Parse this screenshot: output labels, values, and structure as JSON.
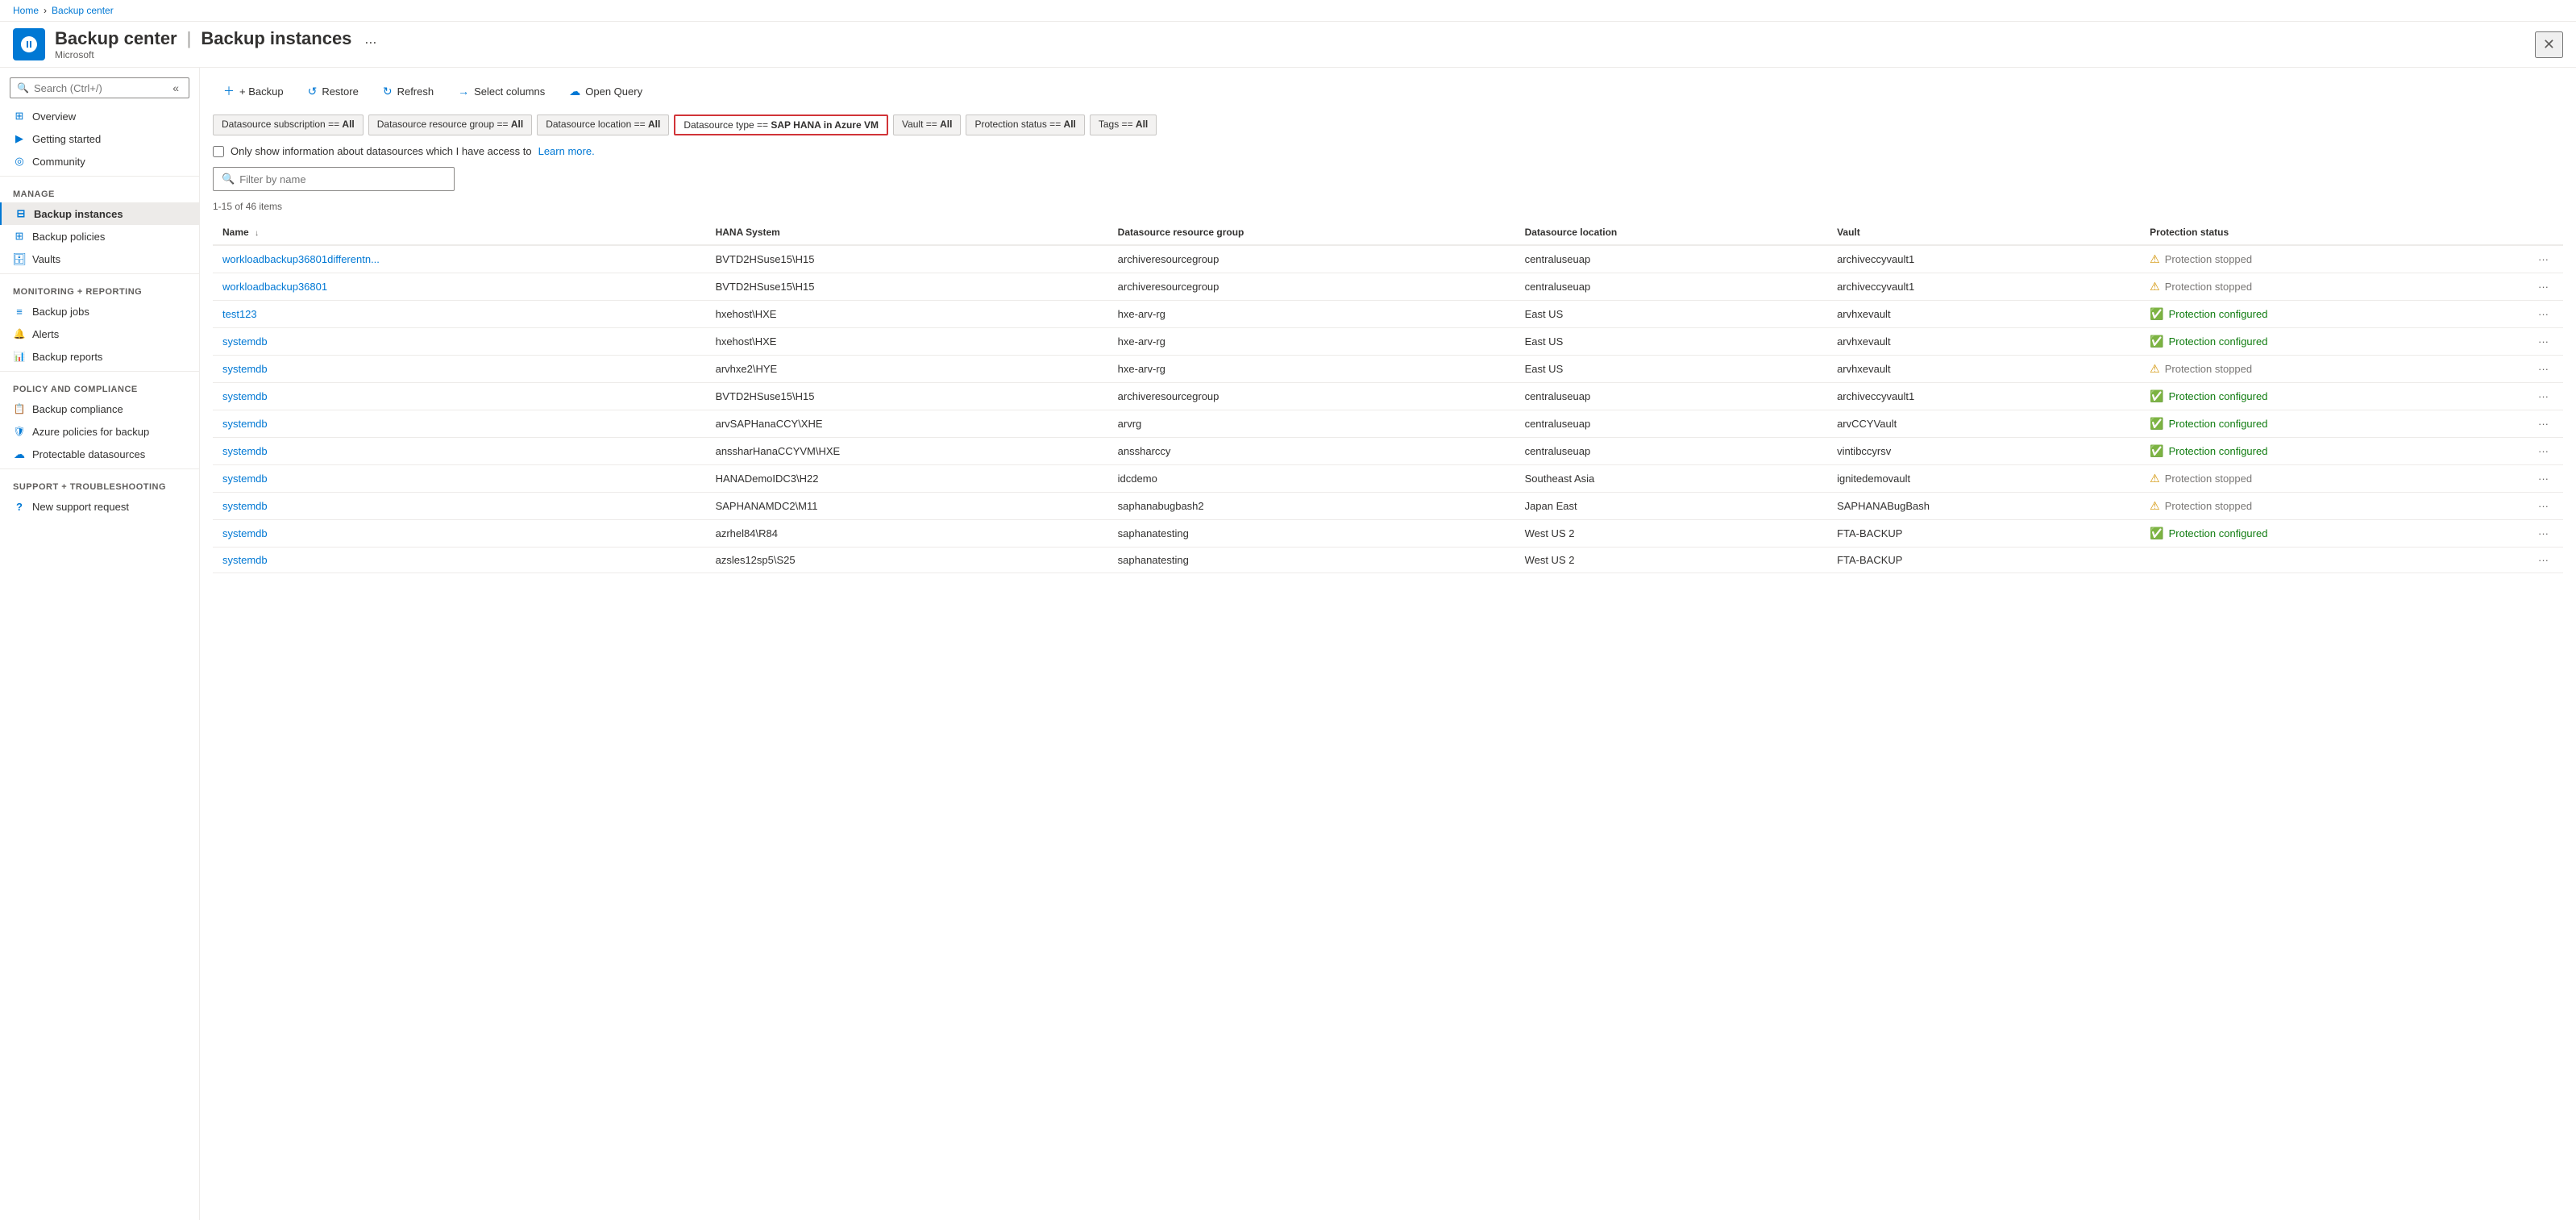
{
  "breadcrumb": {
    "home": "Home",
    "current": "Backup center"
  },
  "header": {
    "title": "Backup center",
    "subtitle": "Microsoft",
    "divider": "|",
    "section": "Backup instances",
    "more_label": "...",
    "close_label": "✕"
  },
  "sidebar": {
    "search_placeholder": "Search (Ctrl+/)",
    "collapse_label": "«",
    "nav_items": [
      {
        "id": "overview",
        "label": "Overview",
        "icon": "overview",
        "section": ""
      },
      {
        "id": "getting-started",
        "label": "Getting started",
        "icon": "getting-started",
        "section": ""
      },
      {
        "id": "community",
        "label": "Community",
        "icon": "community",
        "section": ""
      }
    ],
    "manage_section": "Manage",
    "manage_items": [
      {
        "id": "backup-instances",
        "label": "Backup instances",
        "icon": "backup-instances",
        "active": true
      },
      {
        "id": "backup-policies",
        "label": "Backup policies",
        "icon": "backup-policies"
      },
      {
        "id": "vaults",
        "label": "Vaults",
        "icon": "vaults"
      }
    ],
    "monitoring_section": "Monitoring + reporting",
    "monitoring_items": [
      {
        "id": "backup-jobs",
        "label": "Backup jobs",
        "icon": "backup-jobs"
      },
      {
        "id": "alerts",
        "label": "Alerts",
        "icon": "alerts"
      },
      {
        "id": "backup-reports",
        "label": "Backup reports",
        "icon": "backup-reports"
      }
    ],
    "policy_section": "Policy and compliance",
    "policy_items": [
      {
        "id": "backup-compliance",
        "label": "Backup compliance",
        "icon": "backup-compliance"
      },
      {
        "id": "azure-policies",
        "label": "Azure policies for backup",
        "icon": "azure-policies"
      },
      {
        "id": "protectable",
        "label": "Protectable datasources",
        "icon": "protectable"
      }
    ],
    "support_section": "Support + troubleshooting",
    "support_items": [
      {
        "id": "new-support",
        "label": "New support request",
        "icon": "support"
      }
    ]
  },
  "toolbar": {
    "backup_label": "+ Backup",
    "restore_label": "Restore",
    "refresh_label": "Refresh",
    "select_columns_label": "Select columns",
    "open_query_label": "Open Query"
  },
  "filters": [
    {
      "id": "subscription",
      "label": "Datasource subscription == ",
      "value": "All",
      "highlighted": false
    },
    {
      "id": "resource-group",
      "label": "Datasource resource group == ",
      "value": "All",
      "highlighted": false
    },
    {
      "id": "location",
      "label": "Datasource location == ",
      "value": "All",
      "highlighted": false
    },
    {
      "id": "type",
      "label": "Datasource type == ",
      "value": "SAP HANA in Azure VM",
      "highlighted": true
    },
    {
      "id": "vault",
      "label": "Vault == ",
      "value": "All",
      "highlighted": false
    },
    {
      "id": "protection-status",
      "label": "Protection status == ",
      "value": "All",
      "highlighted": false
    },
    {
      "id": "tags",
      "label": "Tags == ",
      "value": "All",
      "highlighted": false
    }
  ],
  "checkbox": {
    "label": "Only show information about datasources which I have access to",
    "learn_more": "Learn more.",
    "checked": false
  },
  "filter_input": {
    "placeholder": "Filter by name"
  },
  "items_count": "1-15 of 46 items",
  "table": {
    "columns": [
      {
        "id": "name",
        "label": "Name",
        "sortable": true
      },
      {
        "id": "hana-system",
        "label": "HANA System",
        "sortable": false
      },
      {
        "id": "resource-group",
        "label": "Datasource resource group",
        "sortable": false
      },
      {
        "id": "location",
        "label": "Datasource location",
        "sortable": false
      },
      {
        "id": "vault",
        "label": "Vault",
        "sortable": false
      },
      {
        "id": "protection-status",
        "label": "Protection status",
        "sortable": false
      }
    ],
    "rows": [
      {
        "name": "workloadbackup36801differentn...",
        "hana_system": "BVTD2HSuse15\\H15",
        "resource_group": "archiveresourcegroup",
        "location": "centraluseuap",
        "vault": "archiveccyvault1",
        "protection_status": "Protection stopped",
        "status_type": "stopped"
      },
      {
        "name": "workloadbackup36801",
        "hana_system": "BVTD2HSuse15\\H15",
        "resource_group": "archiveresourcegroup",
        "location": "centraluseuap",
        "vault": "archiveccyvault1",
        "protection_status": "Protection stopped",
        "status_type": "stopped"
      },
      {
        "name": "test123",
        "hana_system": "hxehost\\HXE",
        "resource_group": "hxe-arv-rg",
        "location": "East US",
        "vault": "arvhxevault",
        "protection_status": "Protection configured",
        "status_type": "configured"
      },
      {
        "name": "systemdb",
        "hana_system": "hxehost\\HXE",
        "resource_group": "hxe-arv-rg",
        "location": "East US",
        "vault": "arvhxevault",
        "protection_status": "Protection configured",
        "status_type": "configured"
      },
      {
        "name": "systemdb",
        "hana_system": "arvhxe2\\HYE",
        "resource_group": "hxe-arv-rg",
        "location": "East US",
        "vault": "arvhxevault",
        "protection_status": "Protection stopped",
        "status_type": "stopped"
      },
      {
        "name": "systemdb",
        "hana_system": "BVTD2HSuse15\\H15",
        "resource_group": "archiveresourcegroup",
        "location": "centraluseuap",
        "vault": "archiveccyvault1",
        "protection_status": "Protection configured",
        "status_type": "configured"
      },
      {
        "name": "systemdb",
        "hana_system": "arvSAPHanaCCY\\XHE",
        "resource_group": "arvrg",
        "location": "centraluseuap",
        "vault": "arvCCYVault",
        "protection_status": "Protection configured",
        "status_type": "configured"
      },
      {
        "name": "systemdb",
        "hana_system": "anssharHanaCCYVM\\HXE",
        "resource_group": "anssharccy",
        "location": "centraluseuap",
        "vault": "vintibccyrsv",
        "protection_status": "Protection configured",
        "status_type": "configured"
      },
      {
        "name": "systemdb",
        "hana_system": "HANADemoIDC3\\H22",
        "resource_group": "idcdemo",
        "location": "Southeast Asia",
        "vault": "ignitedemovault",
        "protection_status": "Protection stopped",
        "status_type": "stopped"
      },
      {
        "name": "systemdb",
        "hana_system": "SAPHANAMDC2\\M11",
        "resource_group": "saphanabugbash2",
        "location": "Japan East",
        "vault": "SAPHANABugBash",
        "protection_status": "Protection stopped",
        "status_type": "stopped"
      },
      {
        "name": "systemdb",
        "hana_system": "azrhel84\\R84",
        "resource_group": "saphanatesting",
        "location": "West US 2",
        "vault": "FTA-BACKUP",
        "protection_status": "Protection configured",
        "status_type": "configured"
      },
      {
        "name": "systemdb",
        "hana_system": "azsles12sp5\\S25",
        "resource_group": "saphanatesting",
        "location": "West US 2",
        "vault": "FTA-BACKUP",
        "protection_status": "",
        "status_type": "unknown"
      }
    ]
  }
}
